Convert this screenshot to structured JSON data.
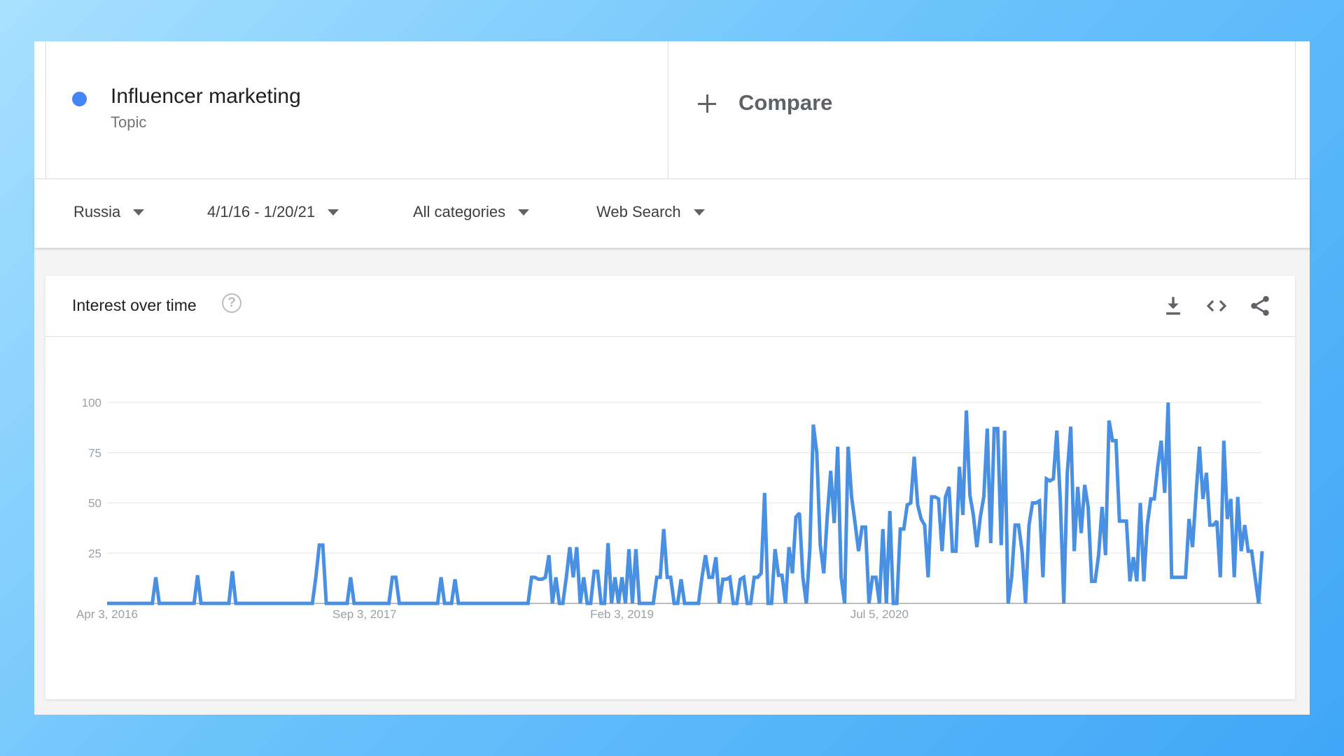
{
  "search": {
    "term": {
      "label": "Influencer marketing",
      "type": "Topic",
      "color": "#4285f4"
    },
    "compare_label": "Compare"
  },
  "filters": {
    "region": "Russia",
    "date_range": "4/1/16 - 1/20/21",
    "category": "All categories",
    "property": "Web Search"
  },
  "card": {
    "title": "Interest over time",
    "help_glyph": "?",
    "icons": [
      "download-icon",
      "embed-icon",
      "share-icon"
    ]
  },
  "chart_data": {
    "type": "line",
    "xlabels": [
      "Apr 3, 2016",
      "Sep 3, 2017",
      "Feb 3, 2019",
      "Jul 5, 2020"
    ],
    "ylabels": [
      "25",
      "50",
      "75",
      "100"
    ],
    "ylim": [
      0,
      100
    ],
    "grid": true,
    "color": "#4a90e2",
    "x_start": "Apr 3, 2016",
    "x_interval": "weekly",
    "series": [
      {
        "values": [
          0,
          0,
          0,
          0,
          0,
          0,
          0,
          0,
          0,
          0,
          0,
          0,
          0,
          0,
          13,
          0,
          0,
          0,
          0,
          0,
          0,
          0,
          0,
          0,
          0,
          0,
          14,
          0,
          0,
          0,
          0,
          0,
          0,
          0,
          0,
          0,
          16,
          0,
          0,
          0,
          0,
          0,
          0,
          0,
          0,
          0,
          0,
          0,
          0,
          0,
          0,
          0,
          0,
          0,
          0,
          0,
          0,
          0,
          0,
          0,
          13,
          29,
          29,
          0,
          0,
          0,
          0,
          0,
          0,
          0,
          13,
          0,
          0,
          0,
          0,
          0,
          0,
          0,
          0,
          0,
          0,
          0,
          13,
          13,
          0,
          0,
          0,
          0,
          0,
          0,
          0,
          0,
          0,
          0,
          0,
          0,
          13,
          0,
          0,
          0,
          12,
          0,
          0,
          0,
          0,
          0,
          0,
          0,
          0,
          0,
          0,
          0,
          0,
          0,
          0,
          0,
          0,
          0,
          0,
          0,
          0,
          0,
          13,
          13,
          12,
          12,
          13,
          24,
          0,
          13,
          0,
          0,
          13,
          28,
          13,
          28,
          0,
          13,
          0,
          0,
          16,
          16,
          0,
          0,
          30,
          0,
          13,
          0,
          13,
          0,
          27,
          0,
          27,
          0,
          0,
          0,
          0,
          0,
          13,
          13,
          37,
          13,
          13,
          0,
          0,
          12,
          0,
          0,
          0,
          0,
          0,
          13,
          24,
          13,
          13,
          23,
          0,
          12,
          12,
          13,
          0,
          0,
          12,
          13,
          0,
          0,
          13,
          13,
          15,
          55,
          0,
          0,
          27,
          14,
          14,
          0,
          28,
          15,
          43,
          45,
          13,
          0,
          27,
          89,
          75,
          29,
          15,
          43,
          66,
          40,
          78,
          13,
          0,
          78,
          53,
          40,
          26,
          38,
          38,
          0,
          13,
          13,
          0,
          37,
          0,
          46,
          0,
          0,
          37,
          37,
          49,
          50,
          73,
          49,
          42,
          39,
          13,
          53,
          53,
          52,
          26,
          53,
          58,
          26,
          26,
          68,
          44,
          96,
          54,
          44,
          28,
          43,
          53,
          87,
          30,
          87,
          87,
          29,
          86,
          0,
          13,
          39,
          39,
          26,
          0,
          39,
          50,
          50,
          51,
          13,
          62,
          61,
          62,
          86,
          51,
          0,
          65,
          88,
          26,
          58,
          35,
          59,
          48,
          11,
          11,
          24,
          48,
          24,
          91,
          81,
          81,
          41,
          41,
          41,
          11,
          23,
          11,
          50,
          11,
          39,
          52,
          52,
          68,
          81,
          55,
          100,
          13,
          13,
          13,
          13,
          13,
          42,
          28,
          54,
          78,
          52,
          65,
          39,
          39,
          41,
          13,
          81,
          42,
          52,
          13,
          53,
          26,
          39,
          26,
          26,
          13,
          0,
          26
        ]
      }
    ]
  }
}
